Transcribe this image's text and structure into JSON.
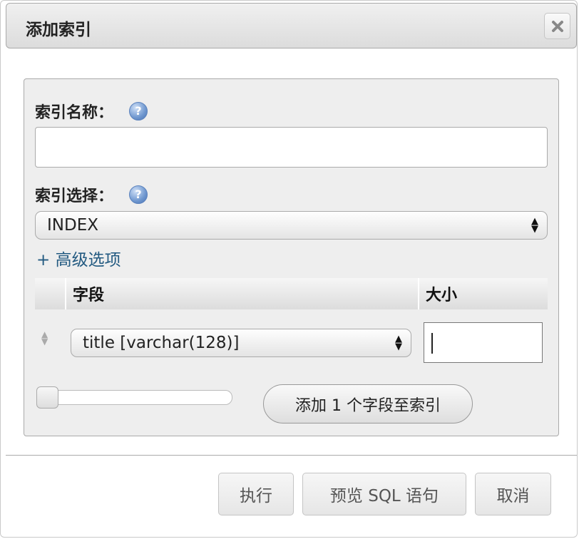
{
  "dialog": {
    "title": "添加索引",
    "close_icon": "×"
  },
  "form": {
    "index_name_label": "索引名称：",
    "index_name_value": "",
    "index_choice_label": "索引选择：",
    "index_choice_value": "INDEX",
    "advanced_options_link": "+ 高级选项",
    "columns_table": {
      "headers": [
        "字段",
        "大小"
      ],
      "rows": [
        {
          "column": "title [varchar(128)]",
          "size": ""
        }
      ]
    },
    "add_column_button": "添加 1 个字段至索引"
  },
  "footer": {
    "execute_button": "执行",
    "preview_sql_button": "预览 SQL 语句",
    "cancel_button": "取消"
  },
  "icons": {
    "help_icon": "question-mark-circle",
    "close_icon": "x-mark",
    "select_arrows": "up-down-arrows",
    "drag_handle": "up-down-arrows"
  },
  "colors": {
    "link": "#235a81",
    "panel_background": "#eeeeee",
    "help_icon": "#6f97cf"
  }
}
